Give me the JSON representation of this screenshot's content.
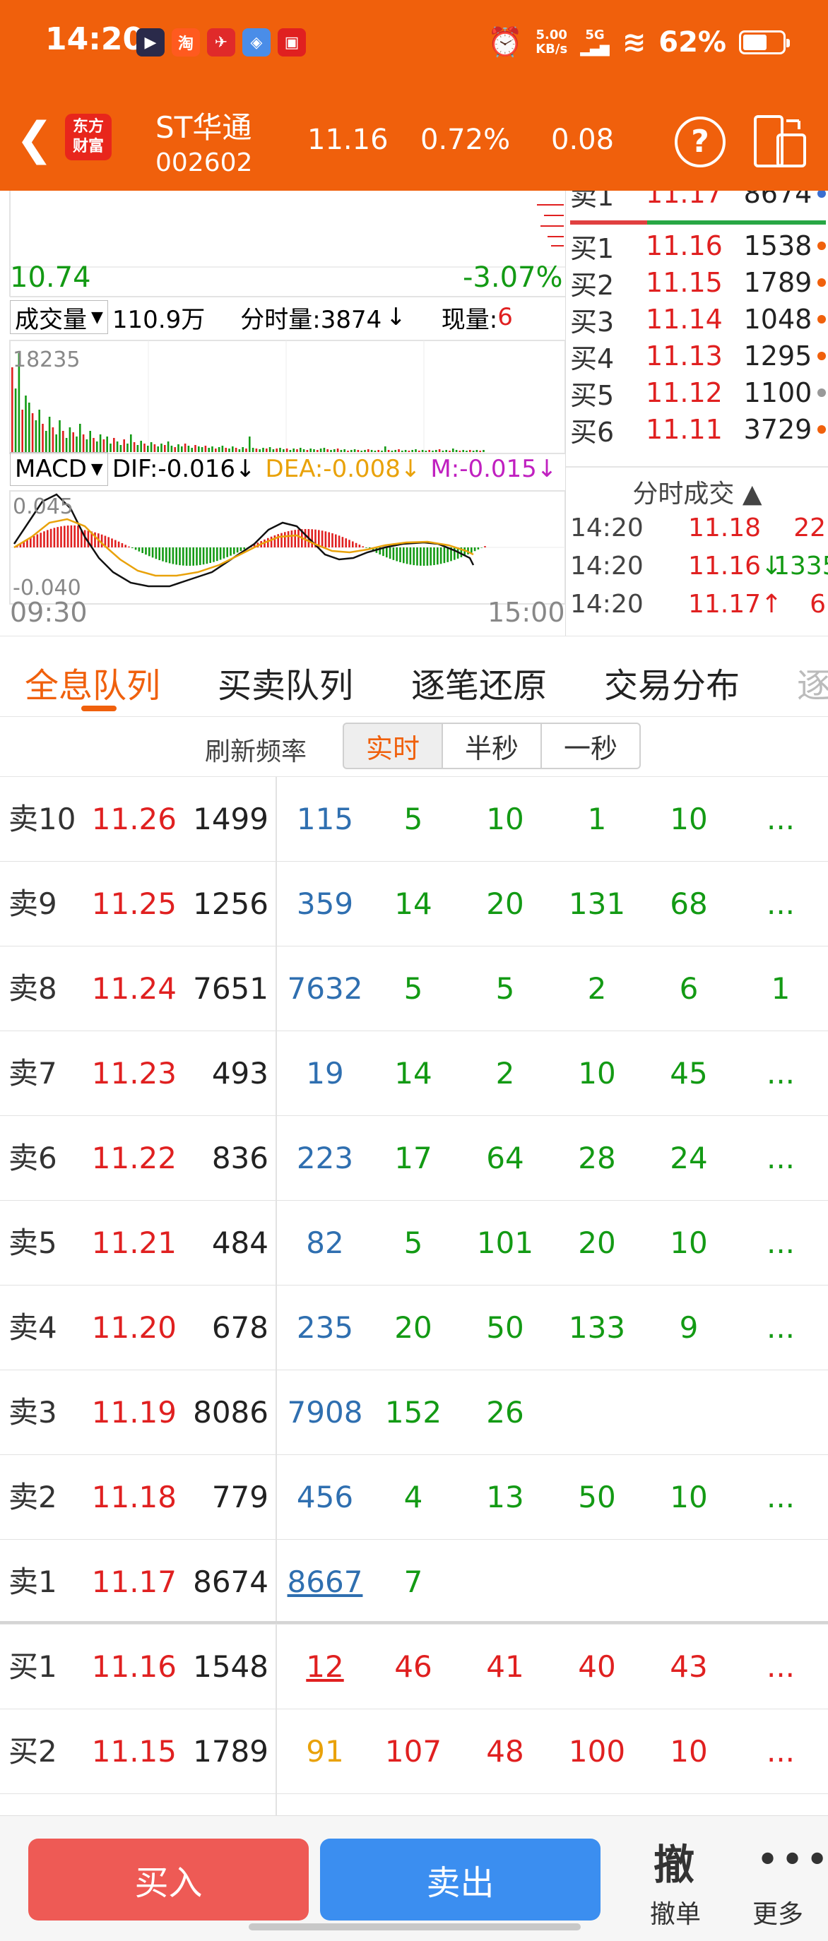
{
  "status": {
    "time": "14:20",
    "netspeed_value": "5.00",
    "netspeed_unit": "KB/s",
    "network": "5G",
    "battery": "62%",
    "battery_level": 0.62
  },
  "header": {
    "back_icon": "back-arrow-icon",
    "logo_line1": "东方",
    "logo_line2": "财富",
    "stock_name": "ST华通",
    "stock_code": "002602",
    "price": "11.16",
    "change_pct": "0.72%",
    "change": "0.08",
    "help": "?"
  },
  "chart": {
    "low_price": "10.74",
    "low_pct": "-3.07%",
    "volume_label": "成交量",
    "volume_total": "110.9万",
    "minute_volume": "分时量:3874",
    "current_volume_label": "现量:",
    "current_volume": "6",
    "vol_axis": "18235",
    "macd_label": "MACD",
    "dif": "DIF:-0.016",
    "dea": "DEA:-0.008",
    "m": "M:-0.015",
    "macd_top": "0.045",
    "macd_bottom": "-0.040",
    "time_start": "09:30",
    "time_end": "15:00",
    "colors": {
      "up": "#e02020",
      "down": "#139a14",
      "dea": "#e9a20a",
      "m": "#c020c0"
    }
  },
  "mini_book": {
    "sell1": {
      "label": "卖1",
      "price": "11.17",
      "vol": "8674"
    },
    "buys": [
      {
        "label": "买1",
        "price": "11.16",
        "vol": "1538",
        "dot": "#f0600c"
      },
      {
        "label": "买2",
        "price": "11.15",
        "vol": "1789",
        "dot": "#f0600c"
      },
      {
        "label": "买3",
        "price": "11.14",
        "vol": "1048",
        "dot": "#f0600c"
      },
      {
        "label": "买4",
        "price": "11.13",
        "vol": "1295",
        "dot": "#f0600c"
      },
      {
        "label": "买5",
        "price": "11.12",
        "vol": "1100",
        "dot": "#999999"
      },
      {
        "label": "买6",
        "price": "11.11",
        "vol": "3729",
        "dot": "#f0600c"
      }
    ],
    "ticks_title": "分时成交",
    "ticks": [
      {
        "time": "14:20",
        "price": "11.18",
        "vol": "22",
        "arrow": ""
      },
      {
        "time": "14:20",
        "price": "11.16",
        "vol": "1335",
        "arrow": "↓"
      },
      {
        "time": "14:20",
        "price": "11.17",
        "vol": "6",
        "arrow": "↑"
      }
    ]
  },
  "tabs": [
    "全息队列",
    "买卖队列",
    "逐笔还原",
    "交易分布",
    "逐"
  ],
  "refresh": {
    "label": "刷新频率",
    "options": [
      "实时",
      "半秒",
      "一秒"
    ]
  },
  "queue": [
    {
      "label": "卖10",
      "price": "11.26",
      "vol": "1499",
      "orders": [
        "115",
        "5",
        "10",
        "1",
        "10",
        "..."
      ]
    },
    {
      "label": "卖9",
      "price": "11.25",
      "vol": "1256",
      "orders": [
        "359",
        "14",
        "20",
        "131",
        "68",
        "..."
      ]
    },
    {
      "label": "卖8",
      "price": "11.24",
      "vol": "7651",
      "orders": [
        "7632",
        "5",
        "5",
        "2",
        "6",
        "1"
      ]
    },
    {
      "label": "卖7",
      "price": "11.23",
      "vol": "493",
      "orders": [
        "19",
        "14",
        "2",
        "10",
        "45",
        "..."
      ]
    },
    {
      "label": "卖6",
      "price": "11.22",
      "vol": "836",
      "orders": [
        "223",
        "17",
        "64",
        "28",
        "24",
        "..."
      ]
    },
    {
      "label": "卖5",
      "price": "11.21",
      "vol": "484",
      "orders": [
        "82",
        "5",
        "101",
        "20",
        "10",
        "..."
      ]
    },
    {
      "label": "卖4",
      "price": "11.20",
      "vol": "678",
      "orders": [
        "235",
        "20",
        "50",
        "133",
        "9",
        "..."
      ]
    },
    {
      "label": "卖3",
      "price": "11.19",
      "vol": "8086",
      "orders": [
        "7908",
        "152",
        "26",
        "",
        "",
        ""
      ]
    },
    {
      "label": "卖2",
      "price": "11.18",
      "vol": "779",
      "orders": [
        "456",
        "4",
        "13",
        "50",
        "10",
        "..."
      ]
    },
    {
      "label": "卖1",
      "price": "11.17",
      "vol": "8674",
      "orders": [
        "8667",
        "7",
        "",
        "",
        "",
        ""
      ]
    },
    {
      "label": "买1",
      "price": "11.16",
      "vol": "1548",
      "orders": [
        "12",
        "46",
        "41",
        "40",
        "43",
        "..."
      ]
    },
    {
      "label": "买2",
      "price": "11.15",
      "vol": "1789",
      "orders": [
        "91",
        "107",
        "48",
        "100",
        "10",
        "..."
      ]
    }
  ],
  "bottom": {
    "buy": "买入",
    "sell": "卖出",
    "cancel_icon": "撤",
    "cancel": "撤单",
    "more_icon": "•••",
    "more": "更多",
    "colors": {
      "buy": "#ee5a55",
      "sell": "#3b8ef0"
    }
  }
}
